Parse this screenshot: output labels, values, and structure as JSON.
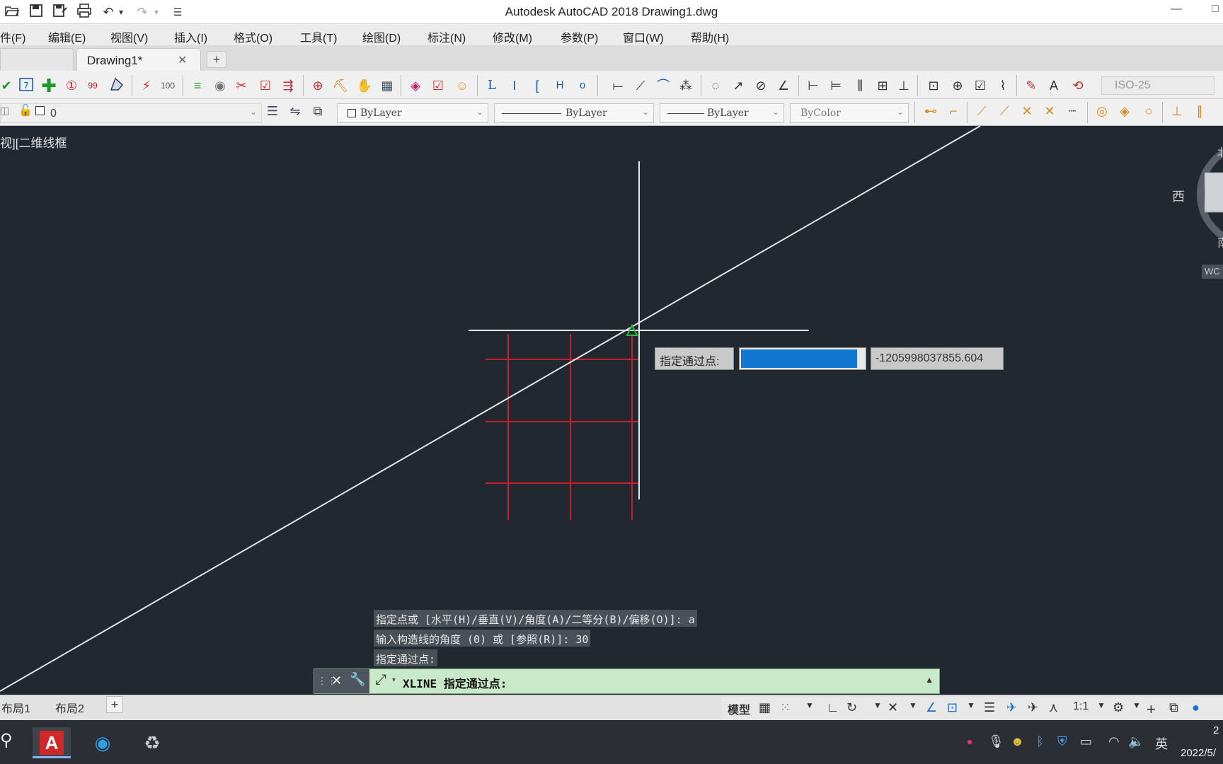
{
  "window": {
    "title": "Autodesk AutoCAD 2018    Drawing1.dwg",
    "minimize_glyph": "—",
    "restore_glyph": "□"
  },
  "quick_access": [
    {
      "name": "open-icon",
      "glyph": "📂"
    },
    {
      "name": "save-icon",
      "glyph": "💾"
    },
    {
      "name": "save-as-icon",
      "glyph": "💾"
    },
    {
      "name": "print-icon",
      "glyph": "🖶"
    },
    {
      "name": "undo-icon",
      "glyph": "↶"
    },
    {
      "name": "undo-dropdown-icon",
      "glyph": "▾"
    },
    {
      "name": "redo-icon",
      "glyph": "↷"
    },
    {
      "name": "redo-dropdown-icon",
      "glyph": "▾"
    },
    {
      "name": "customize-icon",
      "glyph": "☰"
    }
  ],
  "menu": [
    "件(F)",
    "编辑(E)",
    "视图(V)",
    "插入(I)",
    "格式(O)",
    "工具(T)",
    "绘图(D)",
    "标注(N)",
    "修改(M)",
    "参数(P)",
    "窗口(W)",
    "帮助(H)"
  ],
  "tabs": {
    "doc_label": "Drawing1*",
    "close_glyph": "✕",
    "new_glyph": "+"
  },
  "toolbar_dim_style": "ISO-25",
  "layer_toolbar": {
    "layer_value": "0",
    "color_value": "ByLayer",
    "linetype_value": "ByLayer",
    "lineweight_value": "ByLayer",
    "plotstyle_value": "ByColor"
  },
  "viewport_label": "视][二维线框",
  "compass": {
    "west": "西",
    "north_partial": "北",
    "south_partial": "南",
    "wcs": "WC"
  },
  "dynamic_input": {
    "prompt": "指定通过点:",
    "value": "",
    "coordinate": "-1205998037855.604"
  },
  "command_history": [
    "指定点或 [水平(H)/垂直(V)/角度(A)/二等分(B)/偏移(O)]: a",
    "输入构造线的角度 (0) 或 [参照(R)]:  30",
    "指定通过点:"
  ],
  "command_line": {
    "text": "XLINE 指定通过点:",
    "close_glyph": "✕",
    "settings_glyph": "🔧",
    "up_glyph": "▲"
  },
  "layout_tabs": [
    "布局1",
    "布局2"
  ],
  "layout_add_glyph": "+",
  "status": {
    "model_label": "模型",
    "scale": "1:1"
  },
  "taskbar": {
    "search_glyph": "⚲",
    "ime_label": "英",
    "clock_time": "2",
    "clock_date": "2022/5/"
  },
  "colors": {
    "canvas_bg": "#212830",
    "grid_red": "#c8202a",
    "xline_white": "#e4e4e4",
    "selection_blue": "#1177d0",
    "command_green": "#c8eac8"
  }
}
